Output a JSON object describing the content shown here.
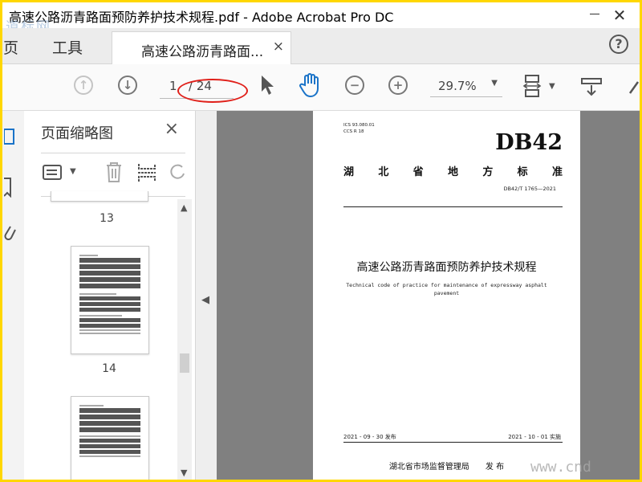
{
  "window": {
    "title": "高速公路沥青路面预防养护技术规程.pdf - Adobe Acrobat Pro DC",
    "watermark_top": "道标网",
    "watermark_bottom": "www.cnd"
  },
  "tabs": {
    "home": "主页",
    "tools": "工具",
    "document": "高速公路沥青路面...",
    "close": "×"
  },
  "toolbar": {
    "current_page": "1",
    "total_pages": "/ 24",
    "zoom": "29.7%"
  },
  "thumbnail_panel": {
    "title": "页面缩略图",
    "close": "×",
    "pages": [
      {
        "label": "13"
      },
      {
        "label": "14"
      }
    ]
  },
  "page": {
    "ics_line": "ICS  93.080.01",
    "ccs_line": "CCS  R 18",
    "db_code": "DB42",
    "standard_type_chars": [
      "湖",
      "北",
      "省",
      "地",
      "方",
      "标",
      "准"
    ],
    "std_number": "DB42/T 1765—2021",
    "title_cn": "高速公路沥青路面预防养护技术规程",
    "title_en": "Technical code of practice for maintenance of expressway asphalt pavement",
    "issue_date": "2021 - 09 - 30 发布",
    "impl_date": "2021 - 10 - 01 实施",
    "issuer": "湖北省市场监督管理局　　发 布"
  },
  "colors": {
    "frame_border": "#ffd700",
    "annotation_ellipse": "#e0201a",
    "hand_tool": "#1a73c8"
  }
}
